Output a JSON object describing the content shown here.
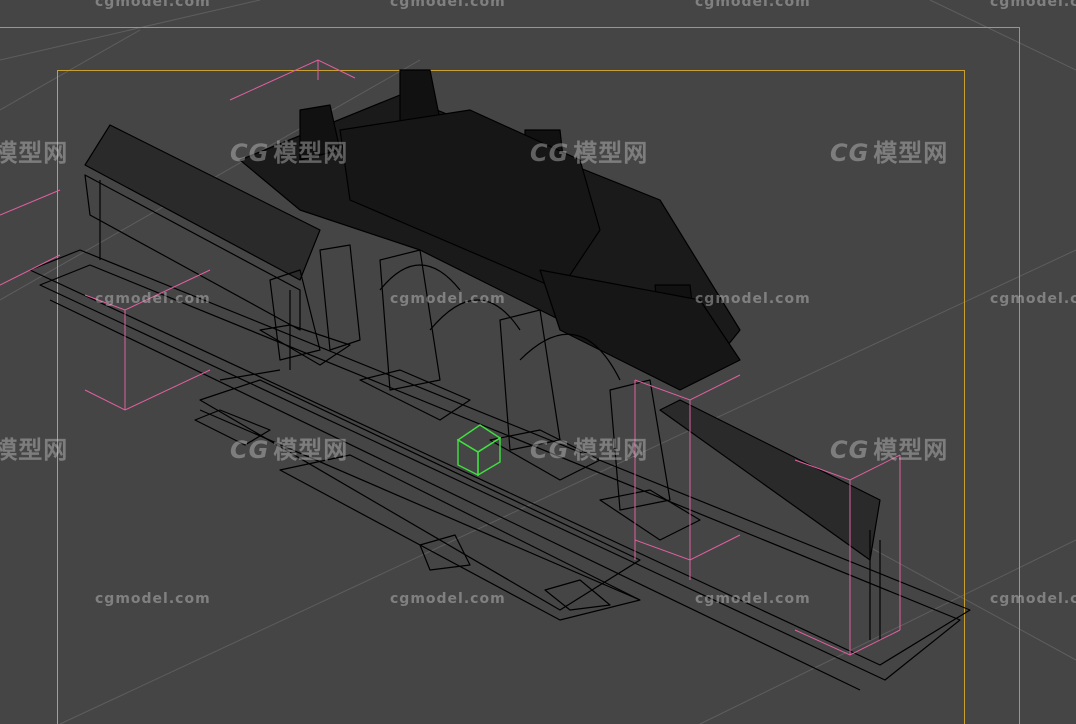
{
  "viewport": {
    "background": "#454545",
    "wire_color": "#000000",
    "frame_colors": {
      "camera": "#3fb8c8",
      "safe": "#c8a030",
      "light": "#e060a0",
      "helper": "#40e040"
    }
  },
  "watermark": {
    "text": "cgmodel.com",
    "logo_prefix": "CG",
    "logo_text": "模型网"
  }
}
